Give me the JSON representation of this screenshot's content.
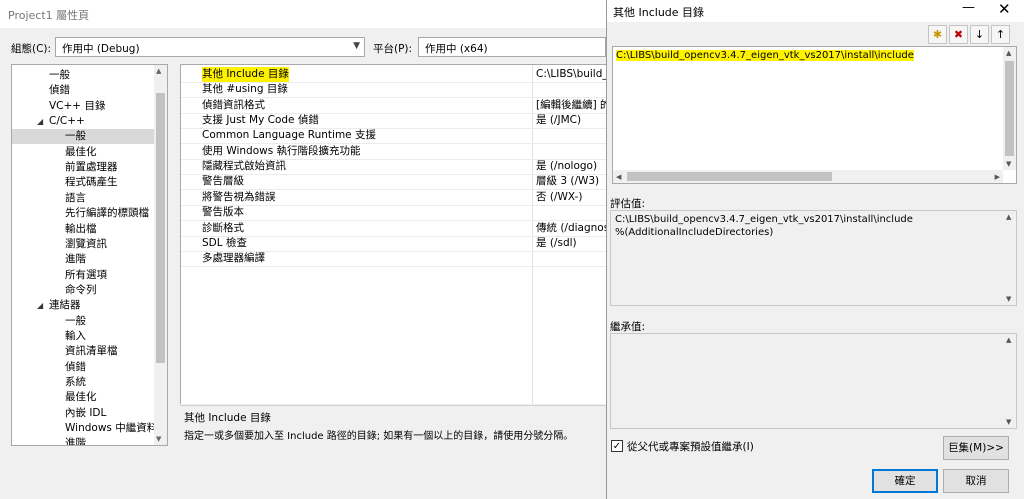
{
  "prop_window": {
    "title": "Project1 屬性頁",
    "config_label": "組態(C):",
    "config_value": "作用中 (Debug)",
    "platform_label": "平台(P):",
    "platform_value": "作用中 (x64)"
  },
  "tree": {
    "items": [
      {
        "label": "一般"
      },
      {
        "label": "偵錯"
      },
      {
        "label": "VC++ 目錄"
      },
      {
        "label": "C/C++",
        "expander": "◢"
      },
      {
        "label": "一般",
        "selected": true
      },
      {
        "label": "最佳化"
      },
      {
        "label": "前置處理器"
      },
      {
        "label": "程式碼產生"
      },
      {
        "label": "語言"
      },
      {
        "label": "先行編譯的標頭檔"
      },
      {
        "label": "輸出檔"
      },
      {
        "label": "瀏覽資訊"
      },
      {
        "label": "進階"
      },
      {
        "label": "所有選項"
      },
      {
        "label": "命令列"
      },
      {
        "label": "連結器",
        "expander": "◢"
      },
      {
        "label": "一般"
      },
      {
        "label": "輸入"
      },
      {
        "label": "資訊清單檔"
      },
      {
        "label": "偵錯"
      },
      {
        "label": "系統"
      },
      {
        "label": "最佳化"
      },
      {
        "label": "內嵌 IDL"
      },
      {
        "label": "Windows 中繼資料"
      },
      {
        "label": "進階"
      }
    ]
  },
  "grid": {
    "rows": [
      {
        "name": "其他 Include 目錄",
        "value": "C:\\LIBS\\build_",
        "highlight": true
      },
      {
        "name": "其他 #using 目錄",
        "value": ""
      },
      {
        "name": "偵錯資訊格式",
        "value": "[編輯後繼續] 的"
      },
      {
        "name": "支援 Just My Code 偵錯",
        "value": "是 (/JMC)"
      },
      {
        "name": "Common Language Runtime 支援",
        "value": ""
      },
      {
        "name": "使用 Windows 執行階段擴充功能",
        "value": ""
      },
      {
        "name": "隱藏程式啟始資訊",
        "value": "是 (/nologo)"
      },
      {
        "name": "警告層級",
        "value": "層級 3 (/W3)"
      },
      {
        "name": "將警告視為錯誤",
        "value": "否 (/WX-)"
      },
      {
        "name": "警告版本",
        "value": ""
      },
      {
        "name": "診斷格式",
        "value": "傳統 (/diagnos"
      },
      {
        "name": "SDL 檢查",
        "value": "是 (/sdl)"
      },
      {
        "name": "多處理器編譯",
        "value": ""
      }
    ]
  },
  "description": {
    "title": "其他 Include 目錄",
    "text": "指定一或多個要加入至 Include 路徑的目錄; 如果有一個以上的目錄，請使用分號分隔。"
  },
  "include_dialog": {
    "title": "其他 Include 目錄",
    "minimize_glyph": "—",
    "close_glyph": "✕",
    "toolbar": {
      "new_line_glyph": "✱",
      "delete_glyph": "✖",
      "move_down_glyph": "↓",
      "move_up_glyph": "↑"
    },
    "list_items": [
      "C:\\LIBS\\build_opencv3.4.7_eigen_vtk_vs2017\\install\\include"
    ],
    "evaluated_label": "評估值:",
    "evaluated_lines": [
      "C:\\LIBS\\build_opencv3.4.7_eigen_vtk_vs2017\\install\\include",
      "%(AdditionalIncludeDirectories)"
    ],
    "inherited_label": "繼承值:",
    "inherit_checkbox_label": "從父代或專案預設值繼承(I)",
    "inherit_checked": true,
    "macros_button": "巨集(M)>>",
    "ok_button": "確定",
    "cancel_button": "取消"
  },
  "colors": {
    "highlight": "#fff200",
    "ok_border": "#0078d7"
  }
}
